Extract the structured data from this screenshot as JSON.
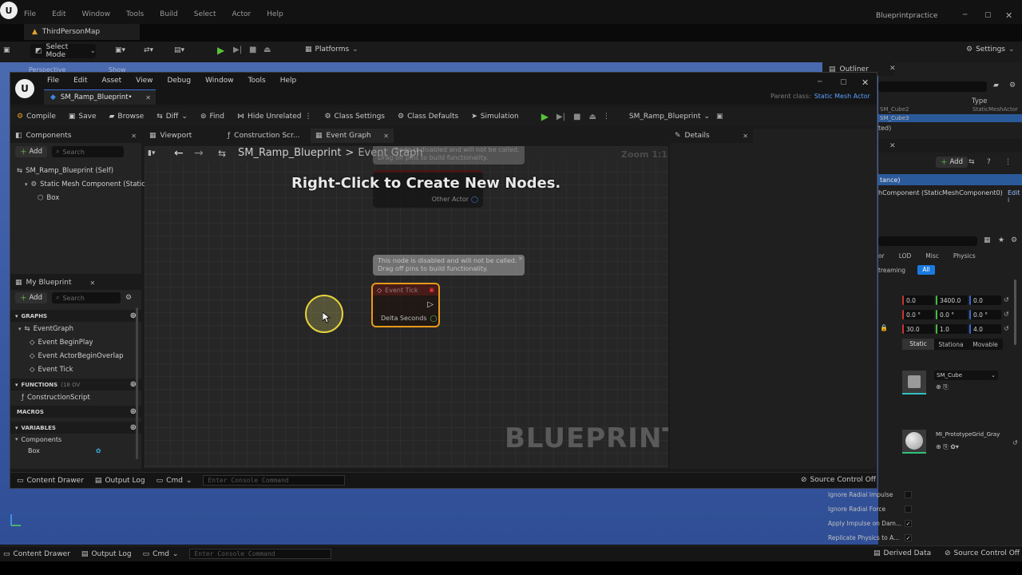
{
  "outer": {
    "menu": [
      "File",
      "Edit",
      "Window",
      "Tools",
      "Build",
      "Select",
      "Actor",
      "Help"
    ],
    "project_name": "Blueprintpractice",
    "map_tab": "ThirdPersonMap",
    "select_mode": "Select Mode",
    "platforms": "Platforms",
    "settings": "Settings",
    "viewport_mode": "Perspective",
    "viewport_show": "Show",
    "outliner_title": "Outliner",
    "outliner_col_type": "Type",
    "outliner_row1": "SM_Cube2",
    "outliner_row1_type": "StaticMeshActor",
    "outliner_row2": "SM_Cube3",
    "outliner_count": "ted)",
    "details_add": "Add",
    "details_instance": "tance)",
    "details_component": "hComponent (StaticMeshComponent0)",
    "details_edit": "Edit i",
    "filter_tabs": [
      "or",
      "LOD",
      "Misc",
      "Physics"
    ],
    "filter_tabs2": [
      "treaming",
      "All"
    ],
    "transform": {
      "loc": [
        "0.0",
        "3400.0",
        "0.0"
      ],
      "rot": [
        "0.0 °",
        "0.0 °",
        "0.0 °"
      ],
      "scale": [
        "30.0",
        "1.0",
        "4.0"
      ]
    },
    "mobility": [
      "Static",
      "Stationa",
      "Movable"
    ],
    "mesh_name": "SM_Cube",
    "material_name": "MI_PrototypeGrid_Gray",
    "physics_rows": [
      "Ignore Radial Impulse",
      "Ignore Radial Force",
      "Apply Impulse on Dam...",
      "Replicate Physics to A..."
    ],
    "status": {
      "content_drawer": "Content Drawer",
      "output_log": "Output Log",
      "cmd": "Cmd",
      "console_placeholder": "Enter Console Command",
      "derived_data": "Derived Data",
      "source_control": "Source Control Off"
    }
  },
  "bp": {
    "menu": [
      "File",
      "Edit",
      "Asset",
      "View",
      "Debug",
      "Window",
      "Tools",
      "Help"
    ],
    "tab_title": "SM_Ramp_Blueprint•",
    "parent_class_label": "Parent class:",
    "parent_class_value": "Static Mesh Actor",
    "toolbar": {
      "compile": "Compile",
      "save": "Save",
      "browse": "Browse",
      "diff": "Diff",
      "find": "Find",
      "hide_unrelated": "Hide Unrelated",
      "class_settings": "Class Settings",
      "class_defaults": "Class Defaults",
      "simulation": "Simulation",
      "debug_object": "SM_Ramp_Blueprint"
    },
    "components": {
      "title": "Components",
      "add": "Add",
      "search_placeholder": "Search",
      "tree": [
        "SM_Ramp_Blueprint (Self)",
        "Static Mesh Component (StaticM",
        "Box"
      ]
    },
    "my_blueprint": {
      "title": "My Blueprint",
      "add": "Add",
      "search_placeholder": "Search",
      "graphs_label": "GRAPHS",
      "event_graph": "EventGraph",
      "events": [
        "Event BeginPlay",
        "Event ActorBeginOverlap",
        "Event Tick"
      ],
      "functions_label": "FUNCTIONS",
      "functions_count": "(18 OV",
      "construction_script": "ConstructionScript",
      "macros_label": "MACROS",
      "variables_label": "VARIABLES",
      "components_cat": "Components",
      "box_var": "Box"
    },
    "tabs": {
      "viewport": "Viewport",
      "construction": "Construction Scr...",
      "event_graph": "Event Graph",
      "details": "Details"
    },
    "graph": {
      "breadcrumb_root": "SM_Ramp_Blueprint",
      "breadcrumb_sep": ">",
      "breadcrumb_current": "Event Graph",
      "zoom": "Zoom 1:1",
      "hint": "Right-Click to Create New Nodes.",
      "disabled_msg_1": "This node is disabled and will not be called.",
      "disabled_msg_2": "Drag off pins to build functionality.",
      "top_partial_1": "node is disabled and will not be called.",
      "top_partial_2": "Drag off pins to build functionality.",
      "other_actor": "Other Actor",
      "event_tick": "Event Tick",
      "delta_seconds": "Delta Seconds",
      "watermark": "BLUEPRINT"
    },
    "status": {
      "content_drawer": "Content Drawer",
      "output_log": "Output Log",
      "cmd": "Cmd",
      "console_placeholder": "Enter Console Command",
      "source_control": "Source Control Off"
    }
  }
}
